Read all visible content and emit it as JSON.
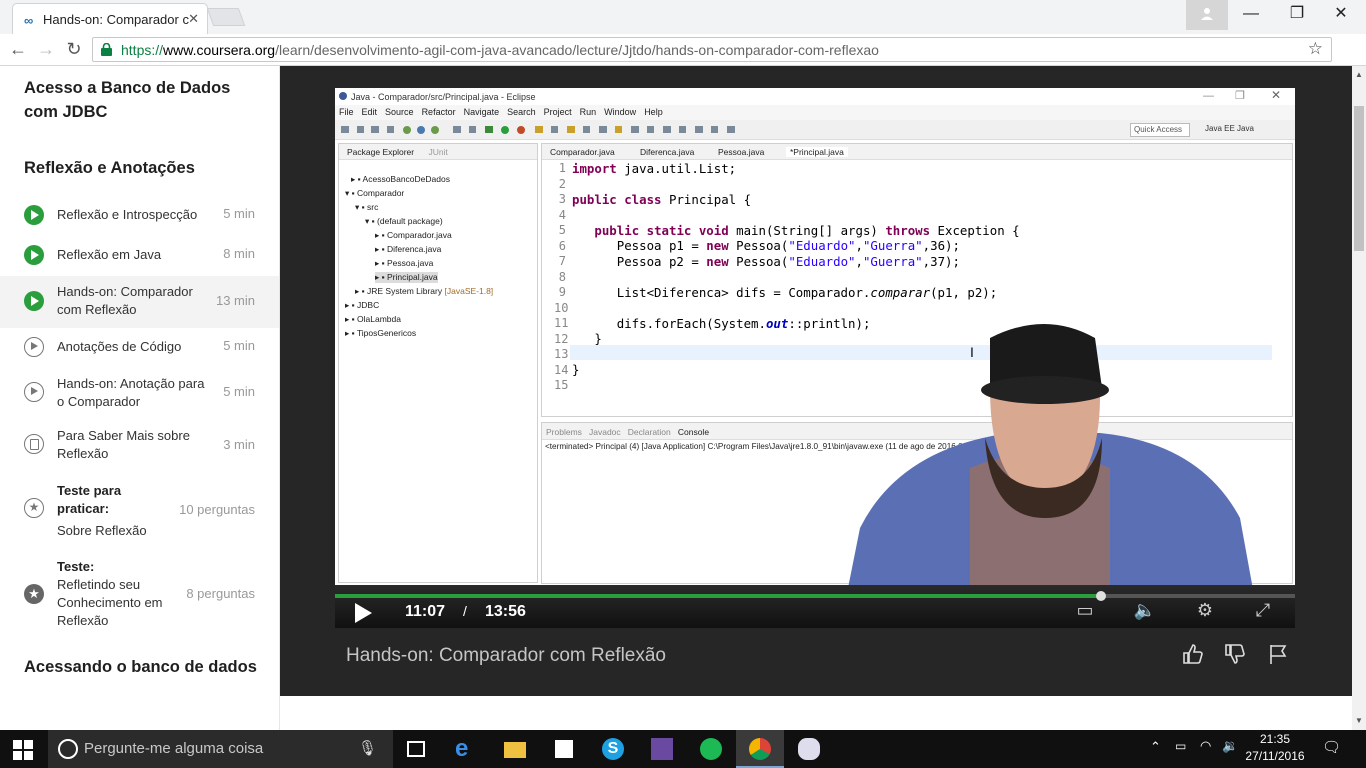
{
  "browser": {
    "tab_title": "Hands-on: Comparador c",
    "url_scheme": "https://",
    "url_host": "www.coursera.org",
    "url_path": "/learn/desenvolvimento-agil-com-java-avancado/lecture/Jjtdo/hands-on-comparador-com-reflexao"
  },
  "sidebar": {
    "section1": "Acesso a Banco de Dados com JDBC",
    "section2": "Reflexão e Anotações",
    "items": [
      {
        "label": "Reflexão e Introspecção",
        "duration": "5 min",
        "icon": "play-filled"
      },
      {
        "label": "Reflexão em Java",
        "duration": "8 min",
        "icon": "play-filled"
      },
      {
        "label": "Hands-on: Comparador com Reflexão",
        "duration": "13 min",
        "icon": "play-filled"
      },
      {
        "label": "Anotações de Código",
        "duration": "5 min",
        "icon": "play-outline"
      },
      {
        "label": "Hands-on: Anotação para o Comparador",
        "duration": "5 min",
        "icon": "play-outline"
      },
      {
        "label": "Para Saber Mais sobre Reflexão",
        "duration": "3 min",
        "icon": "document"
      },
      {
        "label_bold": "Teste para praticar:",
        "label": "Sobre Reflexão",
        "duration": "10 perguntas",
        "icon": "star-outline"
      },
      {
        "label_bold": "Teste:",
        "label": "Refletindo seu Conhecimento em Reflexão",
        "duration": "8 perguntas",
        "icon": "star-filled"
      }
    ],
    "section3": "Acessando o banco de dados"
  },
  "video": {
    "title": "Hands-on: Comparador com Reflexão",
    "time_current": "11:07",
    "time_separator": "/",
    "time_total": "13:56",
    "progress": 0.798
  },
  "eclipse": {
    "window_title": "Java - Comparador/src/Principal.java - Eclipse",
    "menu": [
      "File",
      "Edit",
      "Source",
      "Refactor",
      "Navigate",
      "Search",
      "Project",
      "Run",
      "Window",
      "Help"
    ],
    "quick_access": "Quick Access",
    "perspectives": "Java EE   Java",
    "package_explorer_tab": "Package Explorer",
    "junit_tab": "JUnit",
    "tree": [
      "AcessoBancoDeDados",
      "Comparador",
      "src",
      "(default package)",
      "Comparador.java",
      "Diferenca.java",
      "Pessoa.java",
      "Principal.java",
      "JRE System Library",
      "[JavaSE-1.8]",
      "JDBC",
      "OlaLambda",
      "TiposGenericos"
    ],
    "editor_tabs": [
      "Comparador.java",
      "Diferenca.java",
      "Pessoa.java",
      "*Principal.java"
    ],
    "line_numbers": [
      "1",
      "2",
      "3",
      "4",
      "5",
      "6",
      "7",
      "8",
      "9",
      "10",
      "11",
      "12",
      "13",
      "14",
      "15"
    ],
    "console_tabs": [
      "Problems",
      "Javadoc",
      "Declaration",
      "Console"
    ],
    "console_line": "<terminated> Principal (4) [Java Application] C:\\Program Files\\Java\\jre1.8.0_91\\bin\\javaw.exe (11 de ago de 2016 09"
  },
  "taskbar": {
    "search_placeholder": "Pergunte-me alguma coisa",
    "time": "21:35",
    "date": "27/11/2016"
  },
  "colors": {
    "accent_green": "#2a9d3c",
    "video_bg": "#262626"
  }
}
